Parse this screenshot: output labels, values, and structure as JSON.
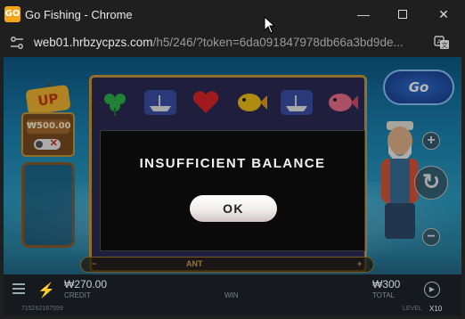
{
  "window": {
    "app_icon_text": "GO",
    "title": "Go Fishing - Chrome",
    "min_glyph": "—",
    "close_glyph": "✕"
  },
  "address": {
    "host": "web01.hrbzycpzs.com",
    "path": "/h5/246/?token=6da091847978db66a3bd9de..."
  },
  "game": {
    "logo_text": "Go",
    "sign_badge": "UP",
    "sign_amount": "₩500.00",
    "sign_toggle_x": "✕",
    "plus_glyph": "+",
    "spin_glyph": "↻",
    "minus_glyph": "−",
    "bet_strip": {
      "left": "−",
      "mid": "ANT",
      "right": "+"
    },
    "bottom": {
      "menu_icon": "menu-icon",
      "turbo_glyph": "⚡",
      "credit_value": "₩270.00",
      "credit_label": "CREDIT",
      "win_label": "WIN",
      "total_value": "₩300",
      "total_label": "TOTAL",
      "autoplay_glyph": "▶",
      "session_id": "715262167599",
      "level_label": "LEVEL",
      "level_value": "X10"
    }
  },
  "modal": {
    "title": "INSUFFICIENT BALANCE",
    "ok_label": "OK"
  },
  "colors": {
    "modal_bg": "#0a0a0a",
    "ok_button": "#f1ecec",
    "reel_frame": "#c99b3c",
    "app_icon": "#f2a516"
  }
}
